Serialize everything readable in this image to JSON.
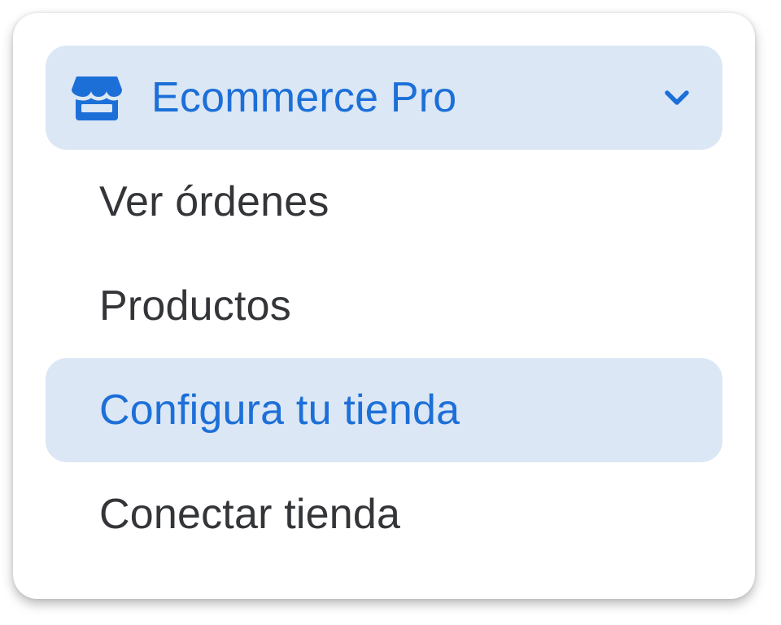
{
  "menu": {
    "header": {
      "label": "Ecommerce Pro",
      "icon": "store-icon",
      "toggle_icon": "chevron-down-icon"
    },
    "items": [
      {
        "label": "Ver órdenes",
        "active": false
      },
      {
        "label": "Productos",
        "active": false
      },
      {
        "label": "Configura tu tienda",
        "active": true
      },
      {
        "label": "Conectar tienda",
        "active": false
      }
    ]
  },
  "colors": {
    "accent": "#1d6fd8",
    "highlight_bg": "#dbe7f5",
    "text": "#333538"
  }
}
